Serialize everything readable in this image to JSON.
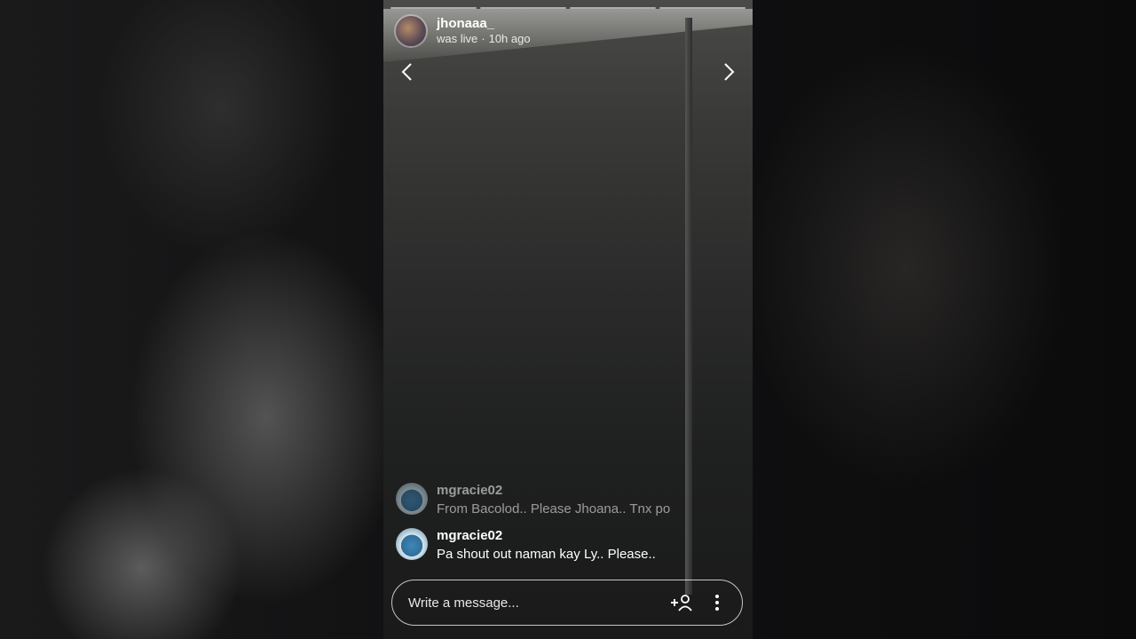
{
  "story": {
    "username": "jhonaaa_",
    "status": "was live",
    "time": "10h ago",
    "segments": 4
  },
  "comments": [
    {
      "user": "mgracie02",
      "message": "From Bacolod.. Please Jhoana.. Tnx po"
    },
    {
      "user": "mgracie02",
      "message": "Pa shout out naman kay Ly.. Please.."
    }
  ],
  "composer": {
    "placeholder": "Write a message..."
  },
  "icons": {
    "prev": "chevron-left-icon",
    "next": "chevron-right-icon",
    "invite": "add-person-icon",
    "more": "more-vertical-icon"
  }
}
